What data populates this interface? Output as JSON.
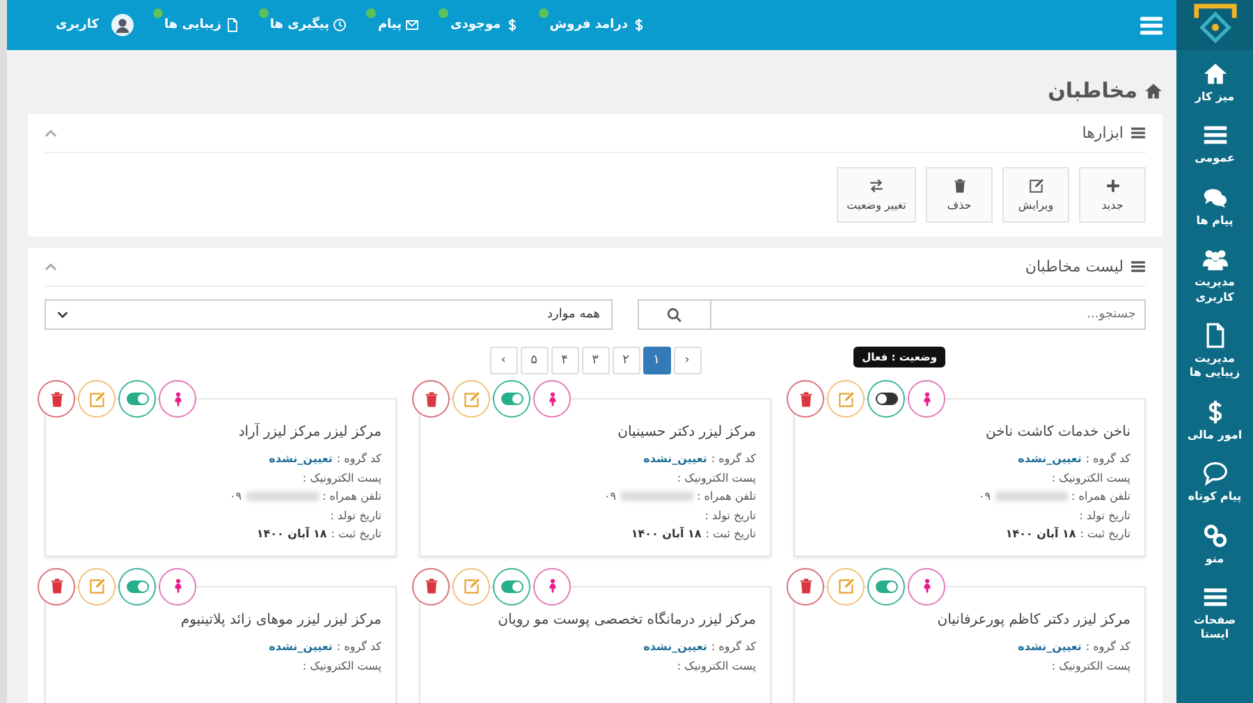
{
  "sidebar": {
    "items": [
      {
        "label": "میز کار"
      },
      {
        "label": "عمومی"
      },
      {
        "label": "پیام ها"
      },
      {
        "label": "مدیریت کاربری"
      },
      {
        "label": "مدیریت زیبایی ها"
      },
      {
        "label": "امور مالی"
      },
      {
        "label": "پیام کوتاه"
      },
      {
        "label": "منو"
      },
      {
        "label": "صفحات ایستا"
      }
    ]
  },
  "top_nav": {
    "items": [
      {
        "label": "درامد فروش",
        "badge": true
      },
      {
        "label": "موجودی",
        "badge": true
      },
      {
        "label": "پیام",
        "badge": true
      },
      {
        "label": "پیگیری ها",
        "badge": true
      },
      {
        "label": "زیبایی ها",
        "badge": true
      },
      {
        "label": "کاربری",
        "badge": false
      }
    ]
  },
  "page_title": "مخاطبان",
  "tools_panel": {
    "title": "ابزارها",
    "buttons": [
      {
        "label": "جدید"
      },
      {
        "label": "ویرایش"
      },
      {
        "label": "حذف"
      },
      {
        "label": "تغییر وضعیت"
      }
    ]
  },
  "contacts_panel": {
    "title": "لیست مخاطبان",
    "search": {
      "placeholder": "جستجو..."
    },
    "filter": {
      "value": "همه موارد"
    },
    "pagination": {
      "prev": "‹",
      "next": "›",
      "pages": [
        {
          "label": "۱",
          "selected": true
        },
        {
          "label": "۲",
          "selected": false
        },
        {
          "label": "۳",
          "selected": false
        },
        {
          "label": "۴",
          "selected": false
        },
        {
          "label": "۵",
          "selected": false
        }
      ]
    },
    "cards": [
      {
        "title": "ناخن خدمات کاشت ناخن",
        "active": false,
        "tooltip": "وضعیت : فعال",
        "fields": [
          {
            "kind": "link",
            "label": "کد گروه :",
            "value": "تعیین_نشده"
          },
          {
            "kind": "text",
            "label": "پست الکترونیک :"
          },
          {
            "kind": "phone",
            "label": "تلفن همراه :",
            "value": "۰۹"
          },
          {
            "kind": "text",
            "label": "تاریخ تولد :"
          },
          {
            "kind": "text",
            "label": "تاریخ ثبت :",
            "value": "۱۸ آبان ۱۴۰۰"
          }
        ]
      },
      {
        "title": "مرکز لیزر دکتر حسینیان",
        "active": true,
        "fields": [
          {
            "kind": "link",
            "label": "کد گروه :",
            "value": "تعیین_نشده"
          },
          {
            "kind": "text",
            "label": "پست الکترونیک :"
          },
          {
            "kind": "phone",
            "label": "تلفن همراه :",
            "value": "۰۹"
          },
          {
            "kind": "text",
            "label": "تاریخ تولد :"
          },
          {
            "kind": "text",
            "label": "تاریخ ثبت :",
            "value": "۱۸ آبان ۱۴۰۰"
          }
        ]
      },
      {
        "title": "مرکز لیزر مرکز لیزر آراد",
        "active": true,
        "fields": [
          {
            "kind": "link",
            "label": "کد گروه :",
            "value": "تعیین_نشده"
          },
          {
            "kind": "text",
            "label": "پست الکترونیک :"
          },
          {
            "kind": "phone",
            "label": "تلفن همراه :",
            "value": "۰۹"
          },
          {
            "kind": "text",
            "label": "تاریخ تولد :"
          },
          {
            "kind": "text",
            "label": "تاریخ ثبت :",
            "value": "۱۸ آبان ۱۴۰۰"
          }
        ]
      },
      {
        "title": "مرکز لیزر دکتر کاظم پورعرفانیان",
        "active": true,
        "fields": [
          {
            "kind": "link",
            "label": "کد گروه :",
            "value": "تعیین_نشده"
          },
          {
            "kind": "text",
            "label": "پست الکترونیک :"
          }
        ]
      },
      {
        "title": "مرکز لیزر درمانگاه تخصصی پوست مو رویان",
        "active": true,
        "fields": [
          {
            "kind": "link",
            "label": "کد گروه :",
            "value": "تعیین_نشده"
          },
          {
            "kind": "text",
            "label": "پست الکترونیک :"
          }
        ]
      },
      {
        "title": "مرکز لیزر لیزر موهای زائد پلاتینیوم",
        "active": true,
        "fields": [
          {
            "kind": "link",
            "label": "کد گروه :",
            "value": "تعیین_نشده"
          },
          {
            "kind": "text",
            "label": "پست الکترونیک :"
          }
        ]
      }
    ]
  }
}
